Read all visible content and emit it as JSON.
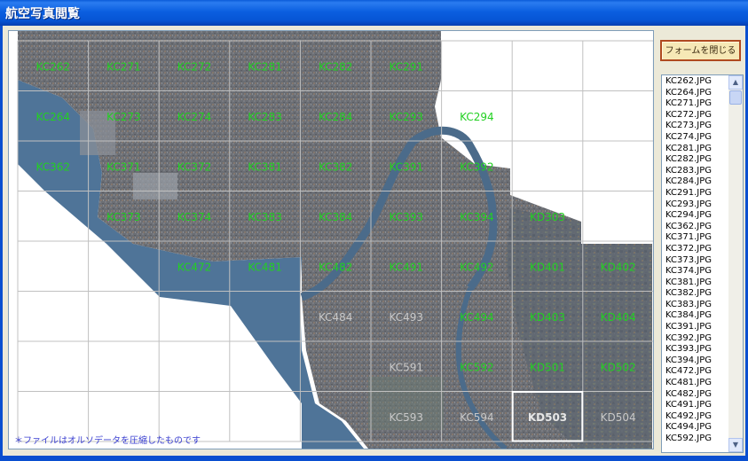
{
  "window": {
    "title": "航空写真閲覧"
  },
  "close_button": {
    "label": "フォームを閉じる"
  },
  "note": "＊ファイルはオルソデータを圧縮したものです",
  "grid": {
    "columns": 9,
    "rows": 8,
    "tiles": [
      {
        "label": "KC262",
        "col": 0,
        "row": 0,
        "state": "available"
      },
      {
        "label": "KC271",
        "col": 1,
        "row": 0,
        "state": "available"
      },
      {
        "label": "KC272",
        "col": 2,
        "row": 0,
        "state": "available"
      },
      {
        "label": "KC281",
        "col": 3,
        "row": 0,
        "state": "available"
      },
      {
        "label": "KC282",
        "col": 4,
        "row": 0,
        "state": "available"
      },
      {
        "label": "KC291",
        "col": 5,
        "row": 0,
        "state": "available"
      },
      {
        "label": "KC264",
        "col": 0,
        "row": 1,
        "state": "available"
      },
      {
        "label": "KC273",
        "col": 1,
        "row": 1,
        "state": "available"
      },
      {
        "label": "KC274",
        "col": 2,
        "row": 1,
        "state": "available"
      },
      {
        "label": "KC283",
        "col": 3,
        "row": 1,
        "state": "available"
      },
      {
        "label": "KC284",
        "col": 4,
        "row": 1,
        "state": "available"
      },
      {
        "label": "KC293",
        "col": 5,
        "row": 1,
        "state": "available"
      },
      {
        "label": "KC294",
        "col": 6,
        "row": 1,
        "state": "available"
      },
      {
        "label": "KC362",
        "col": 0,
        "row": 2,
        "state": "available"
      },
      {
        "label": "KC371",
        "col": 1,
        "row": 2,
        "state": "available"
      },
      {
        "label": "KC372",
        "col": 2,
        "row": 2,
        "state": "available"
      },
      {
        "label": "KC381",
        "col": 3,
        "row": 2,
        "state": "available"
      },
      {
        "label": "KC382",
        "col": 4,
        "row": 2,
        "state": "available"
      },
      {
        "label": "KC391",
        "col": 5,
        "row": 2,
        "state": "available"
      },
      {
        "label": "KC392",
        "col": 6,
        "row": 2,
        "state": "available"
      },
      {
        "label": "KC373",
        "col": 1,
        "row": 3,
        "state": "available"
      },
      {
        "label": "KC374",
        "col": 2,
        "row": 3,
        "state": "available"
      },
      {
        "label": "KC383",
        "col": 3,
        "row": 3,
        "state": "available"
      },
      {
        "label": "KC384",
        "col": 4,
        "row": 3,
        "state": "available"
      },
      {
        "label": "KC393",
        "col": 5,
        "row": 3,
        "state": "available"
      },
      {
        "label": "KC394",
        "col": 6,
        "row": 3,
        "state": "available"
      },
      {
        "label": "KD303",
        "col": 7,
        "row": 3,
        "state": "available"
      },
      {
        "label": "KC472",
        "col": 2,
        "row": 4,
        "state": "available"
      },
      {
        "label": "KC481",
        "col": 3,
        "row": 4,
        "state": "available"
      },
      {
        "label": "KC482",
        "col": 4,
        "row": 4,
        "state": "available"
      },
      {
        "label": "KC491",
        "col": 5,
        "row": 4,
        "state": "available"
      },
      {
        "label": "KC492",
        "col": 6,
        "row": 4,
        "state": "available"
      },
      {
        "label": "KD401",
        "col": 7,
        "row": 4,
        "state": "available"
      },
      {
        "label": "KD402",
        "col": 8,
        "row": 4,
        "state": "available"
      },
      {
        "label": "KC484",
        "col": 4,
        "row": 5,
        "state": "unavailable"
      },
      {
        "label": "KC493",
        "col": 5,
        "row": 5,
        "state": "unavailable"
      },
      {
        "label": "KC494",
        "col": 6,
        "row": 5,
        "state": "available"
      },
      {
        "label": "KD403",
        "col": 7,
        "row": 5,
        "state": "available"
      },
      {
        "label": "KD404",
        "col": 8,
        "row": 5,
        "state": "available"
      },
      {
        "label": "KC591",
        "col": 5,
        "row": 6,
        "state": "unavailable"
      },
      {
        "label": "KC592",
        "col": 6,
        "row": 6,
        "state": "available"
      },
      {
        "label": "KD501",
        "col": 7,
        "row": 6,
        "state": "available"
      },
      {
        "label": "KD502",
        "col": 8,
        "row": 6,
        "state": "available"
      },
      {
        "label": "KC593",
        "col": 5,
        "row": 7,
        "state": "unavailable"
      },
      {
        "label": "KC594",
        "col": 6,
        "row": 7,
        "state": "unavailable"
      },
      {
        "label": "KD503",
        "col": 7,
        "row": 7,
        "state": "selected"
      },
      {
        "label": "KD504",
        "col": 8,
        "row": 7,
        "state": "unavailable"
      }
    ]
  },
  "colors": {
    "available_label": "#22d022",
    "unavailable_label": "#c8c8c8",
    "selected_label": "#e6e6e6",
    "gridline": "#c0c0c0",
    "sea": "#4f7498",
    "land": "#6b6e74"
  },
  "file_list": {
    "items": [
      "KC262.JPG",
      "KC264.JPG",
      "KC271.JPG",
      "KC272.JPG",
      "KC273.JPG",
      "KC274.JPG",
      "KC281.JPG",
      "KC282.JPG",
      "KC283.JPG",
      "KC284.JPG",
      "KC291.JPG",
      "KC293.JPG",
      "KC294.JPG",
      "KC362.JPG",
      "KC371.JPG",
      "KC372.JPG",
      "KC373.JPG",
      "KC374.JPG",
      "KC381.JPG",
      "KC382.JPG",
      "KC383.JPG",
      "KC384.JPG",
      "KC391.JPG",
      "KC392.JPG",
      "KC393.JPG",
      "KC394.JPG",
      "KC472.JPG",
      "KC481.JPG",
      "KC482.JPG",
      "KC491.JPG",
      "KC492.JPG",
      "KC494.JPG",
      "KC592.JPG"
    ],
    "scroll_up_icon": "arrow-up-icon",
    "scroll_down_icon": "arrow-down-icon"
  }
}
